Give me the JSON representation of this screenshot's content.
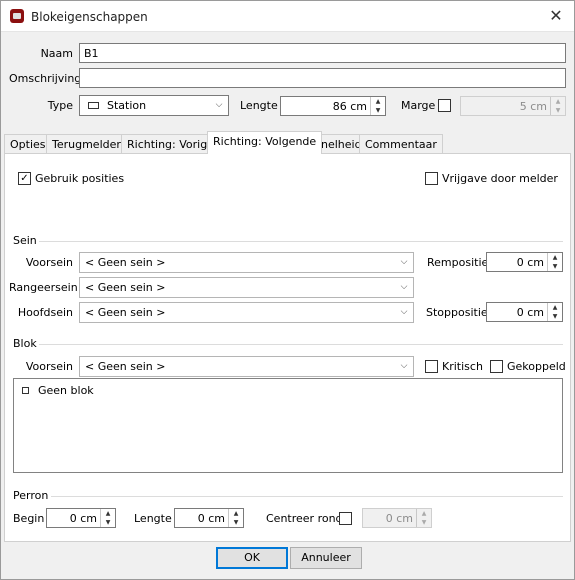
{
  "window": {
    "title": "Blokeigenschappen",
    "close_glyph": "✕"
  },
  "fields": {
    "naam_label": "Naam",
    "naam_value": "B1",
    "omschrijving_label": "Omschrijving",
    "omschrijving_value": "",
    "type_label": "Type",
    "type_value": "Station",
    "lengte_label": "Lengte",
    "lengte_value": "86 cm",
    "marge_label": "Marge",
    "marge_value": "5 cm"
  },
  "tabs": [
    {
      "label": "Opties"
    },
    {
      "label": "Terugmelders"
    },
    {
      "label": "Richting: Vorige"
    },
    {
      "label": "Richting: Volgende"
    },
    {
      "label": "Snelheid"
    },
    {
      "label": "Commentaar"
    }
  ],
  "options": {
    "gebruik_posities_label": "Gebruik posities",
    "gebruik_posities_checked": true,
    "vrijgave_label": "Vrijgave door melder",
    "vrijgave_checked": false
  },
  "sein": {
    "group_label": "Sein",
    "voorsein_label": "Voorsein",
    "voorsein_value": "< Geen sein >",
    "rangeersein_label": "Rangeersein",
    "rangeersein_value": "< Geen sein >",
    "hoofdsein_label": "Hoofdsein",
    "hoofdsein_value": "< Geen sein >",
    "rempositie_label": "Rempositie",
    "rempositie_value": "0 cm",
    "stoppositie_label": "Stoppositie",
    "stoppositie_value": "0 cm"
  },
  "blok": {
    "group_label": "Blok",
    "voorsein_label": "Voorsein",
    "voorsein_value": "< Geen sein >",
    "kritisch_label": "Kritisch",
    "gekoppeld_label": "Gekoppeld",
    "list_items": [
      "Geen blok"
    ]
  },
  "perron": {
    "group_label": "Perron",
    "begin_label": "Begin",
    "begin_value": "0 cm",
    "lengte_label": "Lengte",
    "lengte_value": "0 cm",
    "centreer_label": "Centreer rond",
    "centreer_value": "0 cm"
  },
  "buttons": {
    "ok_label": "OK",
    "annuleer_label": "Annuleer"
  },
  "glyphs": {
    "dropdown": "⌵",
    "spin_up": "▲",
    "spin_down": "▼",
    "check": "✓"
  }
}
